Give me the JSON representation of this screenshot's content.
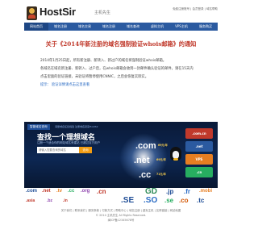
{
  "header": {
    "logo_text": "HostSir",
    "logo_sub": "主机先生",
    "links": "免费注册账号 | 会员登录 | 域名帮助"
  },
  "nav": {
    "items": [
      "网站首页",
      "域名注册",
      "域名交易",
      "域名注册",
      "域名查询",
      "虚拟主机",
      "VPS主机",
      "服务购买"
    ]
  },
  "notice": {
    "title": "关于《2014年新注册的域名强制验证whois邮箱》的通知",
    "lines": [
      "2014年1月25日起，所有新注册、新转入、新过户的域名将强制验证whois邮箱。",
      "各域名在域名新注册、新转入、过户后，在whois邮箱会收到一封邮件确认验证的邮件，请在15天内",
      "点击里面的验证链接，未验证将暂停使用CNNIC，之后会恢复实际实。"
    ],
    "link_prefix": "提示：",
    "link_text": "验证详情请点击这里查看"
  },
  "banner": {
    "tag": "智能域名查询",
    "tag_sub": "海量域名任您挑选 注册域名就来HostSir",
    "headline": "查找一个理想域名",
    "sub": "注册一个适合你的网站域名来建站 已超过百万用户",
    "search_placeholder": "请输入您要查询的域名",
    "search_button": "查询",
    "tlds": [
      {
        "name": ".com",
        "price": "69元/年",
        "color": "#ffffff"
      },
      {
        "name": ".net",
        "price": "69元/年",
        "color": "#ffffff"
      },
      {
        "name": ".cc",
        "price": "71元/年",
        "color": "#ffffff"
      }
    ],
    "chips": [
      {
        "name": ".com.cn",
        "color": "#c0392b"
      },
      {
        "name": ".net",
        "color": "#2b5aa0"
      },
      {
        "name": "VPS",
        "color": "#e67e22"
      },
      {
        "name": ".cn",
        "color": "#27ae60"
      }
    ]
  },
  "tld_strip": [
    {
      "name": ".com",
      "color": "#1f4d96"
    },
    {
      "name": ".net",
      "color": "#c0392b"
    },
    {
      "name": ".tv",
      "color": "#e67e22"
    },
    {
      "name": ".cc",
      "color": "#27ae60"
    },
    {
      "name": ".org",
      "color": "#8e44ad"
    },
    {
      "name": ".cn",
      "color": "#c0392b"
    },
    {
      "name": "GD",
      "color": "#2e8b57"
    },
    {
      "name": ".jp",
      "color": "#1f4d96"
    },
    {
      "name": ".fr",
      "color": "#2b6cc4"
    },
    {
      "name": ".mobi",
      "color": "#e67e22"
    },
    {
      "name": ".asia",
      "color": "#c0392b"
    },
    {
      "name": ".SE",
      "color": "#1f4d96"
    },
    {
      "name": ".SO",
      "color": "#2b6cc4"
    },
    {
      "name": ".se",
      "color": "#27ae60"
    },
    {
      "name": ".co",
      "color": "#d35400"
    },
    {
      "name": ".bz",
      "color": "#8e44ad"
    },
    {
      "name": ".in",
      "color": "#c0392b"
    },
    {
      "name": ".tc",
      "color": "#1f4d96"
    }
  ],
  "footer": {
    "links": "关于我们 | 联系我们 | 服务条款 | 付款方式 | 帮助中心 | 域名注册 | 虚拟主机 | 友情链接 | 网站地图",
    "copyright": "© 2014 主机先生 All Rights Reserved.",
    "icp": "闽ICP备12345678号"
  }
}
